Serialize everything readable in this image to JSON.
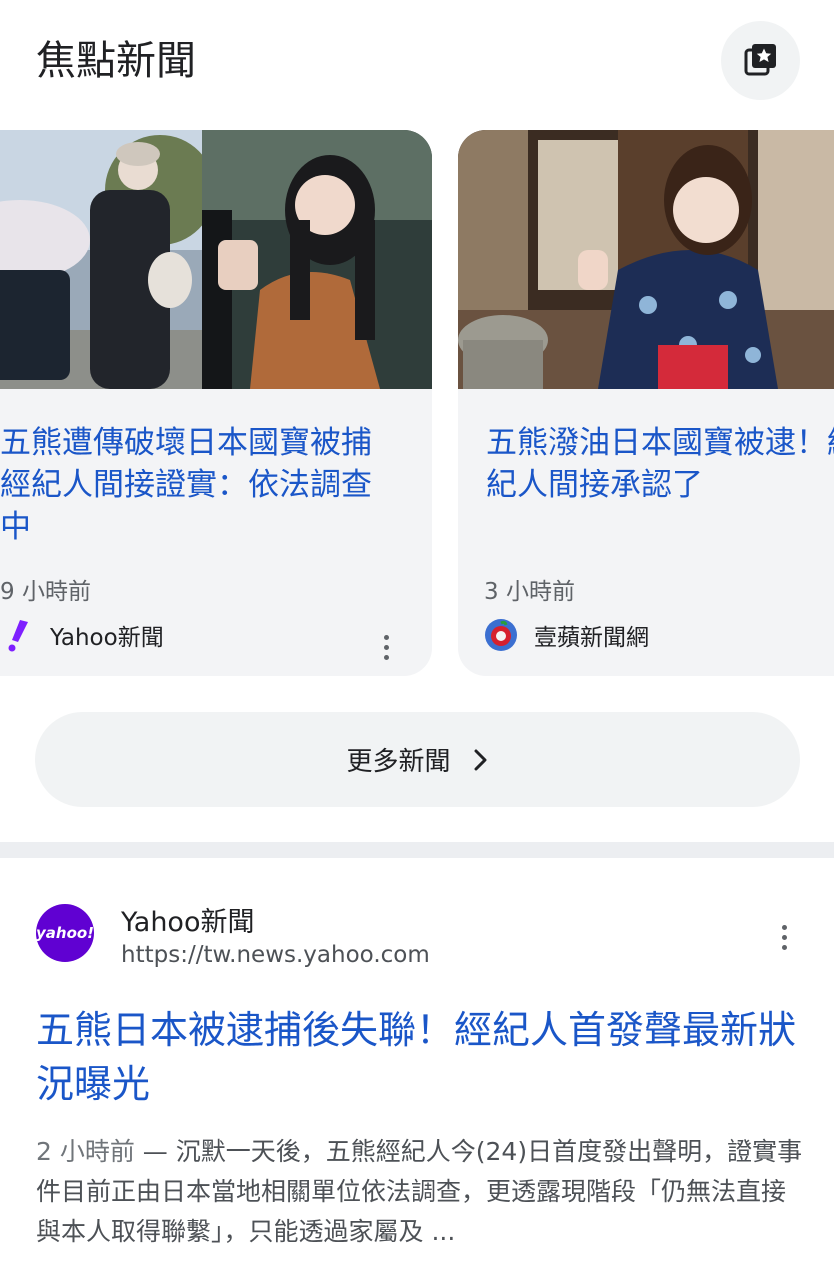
{
  "header": {
    "title": "焦點新聞",
    "action_icon": "collections-star-icon"
  },
  "top_stories": [
    {
      "title": "五熊遭傳破壞日本國寶被捕 經紀人間接證實：依法調查中",
      "time": "9 小時前",
      "source": "Yahoo新聞",
      "source_icon": "yahoo-exclamation-icon",
      "image": "photo-woman-with-stroller-and-portrait"
    },
    {
      "title": "五熊潑油日本國寶被逮！經紀人間接承認了",
      "time": "3 小時前",
      "source": "壹蘋新聞網",
      "source_icon": "nextapple-logo-icon",
      "image": "photo-woman-in-yukata"
    }
  ],
  "more_news": {
    "label": "更多新聞"
  },
  "result": {
    "logo_text": "yahoo!",
    "site_name": "Yahoo新聞",
    "url": "https://tw.news.yahoo.com",
    "title": "五熊日本被逮捕後失聯！經紀人首發聲最新狀況曝光",
    "snippet_time": "2 小時前",
    "snippet_sep": " — ",
    "snippet": "沉默一天後，五熊經紀人今(24)日首度發出聲明，證實事件目前正由日本當地相關單位依法調查，更透露現階段「仍無法直接與本人取得聯繫」，只能透過家屬及 ..."
  },
  "colors": {
    "link": "#1a56c8",
    "card_bg": "#f3f4f6",
    "yahoo_purple": "#6001d2"
  }
}
